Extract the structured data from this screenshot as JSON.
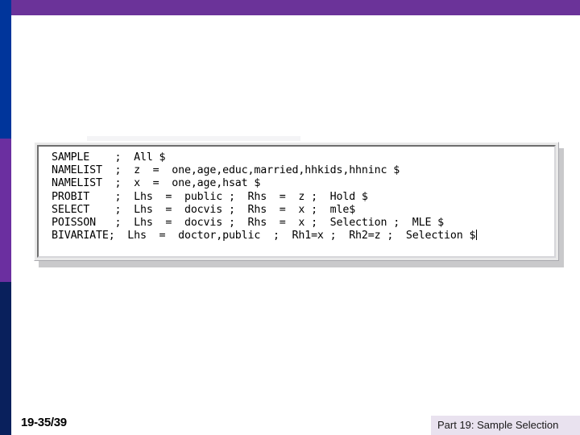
{
  "slide": {
    "background_color": "#ffffff",
    "accent": {
      "topbar_color": "#6b3399",
      "sidebar_top_color": "#00359b",
      "sidebar_mid_color": "#6b2fa0",
      "sidebar_bottom_color": "#09205c"
    }
  },
  "code_window": {
    "title": "",
    "frame_color": "#e9e9e9",
    "page_color": "#ffffff",
    "lines": [
      "SAMPLE    ;  All $",
      "NAMELIST  ;  z  =  one,age,educ,married,hhkids,hhninc $",
      "NAMELIST  ;  x  =  one,age,hsat $",
      "PROBIT    ;  Lhs  =  public ;  Rhs  =  z ;  Hold $",
      "SELECT    ;  Lhs  =  docvis ;  Rhs  =  x ;  mle$",
      "POISSON   ;  Lhs  =  docvis ;  Rhs  =  x ;  Selection ;  MLE $",
      "BIVARIATE;  Lhs  =  doctor,public  ;  Rh1=x ;  Rh2=z ;  Selection $"
    ]
  },
  "footer": {
    "page_number": "19-35/39",
    "title": "Part 19: Sample Selection",
    "title_band_color": "#e9e2ef"
  }
}
